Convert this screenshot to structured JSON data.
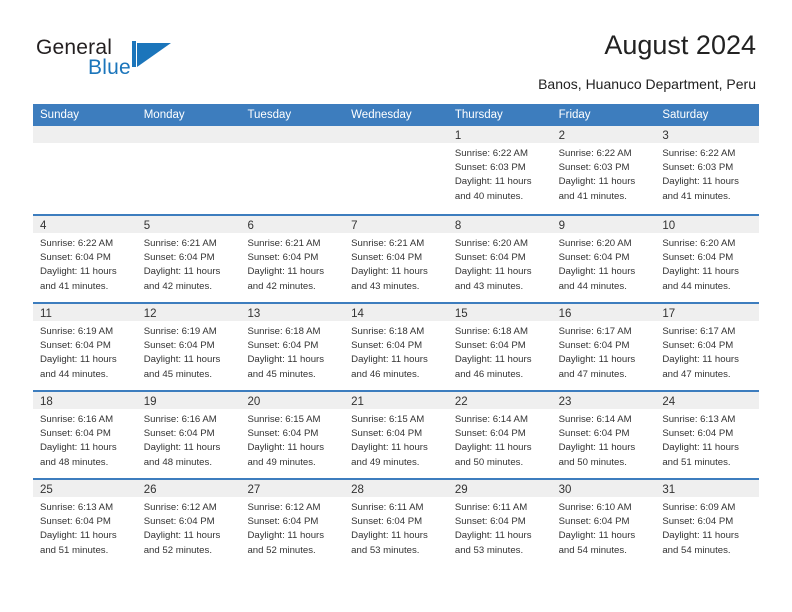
{
  "brand": {
    "name_part1": "General",
    "name_part2": "Blue",
    "mark": "triangle-flag-logo"
  },
  "header": {
    "title": "August 2024",
    "subtitle": "Banos, Huanuco Department, Peru"
  },
  "colors": {
    "header_blue": "#3d7dbe",
    "brand_blue": "#1b75bb",
    "daynum_band": "#efefef",
    "text": "#333333"
  },
  "weekday_headers": [
    "Sunday",
    "Monday",
    "Tuesday",
    "Wednesday",
    "Thursday",
    "Friday",
    "Saturday"
  ],
  "labels": {
    "sunrise_prefix": "Sunrise:",
    "sunset_prefix": "Sunset:",
    "daylight_prefix": "Daylight:"
  },
  "weeks": [
    [
      {
        "day": "",
        "empty": true
      },
      {
        "day": "",
        "empty": true
      },
      {
        "day": "",
        "empty": true
      },
      {
        "day": "",
        "empty": true
      },
      {
        "day": "1",
        "sunrise": "Sunrise: 6:22 AM",
        "sunset": "Sunset: 6:03 PM",
        "daylight_1": "Daylight: 11 hours",
        "daylight_2": "and 40 minutes."
      },
      {
        "day": "2",
        "sunrise": "Sunrise: 6:22 AM",
        "sunset": "Sunset: 6:03 PM",
        "daylight_1": "Daylight: 11 hours",
        "daylight_2": "and 41 minutes."
      },
      {
        "day": "3",
        "sunrise": "Sunrise: 6:22 AM",
        "sunset": "Sunset: 6:03 PM",
        "daylight_1": "Daylight: 11 hours",
        "daylight_2": "and 41 minutes."
      }
    ],
    [
      {
        "day": "4",
        "sunrise": "Sunrise: 6:22 AM",
        "sunset": "Sunset: 6:04 PM",
        "daylight_1": "Daylight: 11 hours",
        "daylight_2": "and 41 minutes."
      },
      {
        "day": "5",
        "sunrise": "Sunrise: 6:21 AM",
        "sunset": "Sunset: 6:04 PM",
        "daylight_1": "Daylight: 11 hours",
        "daylight_2": "and 42 minutes."
      },
      {
        "day": "6",
        "sunrise": "Sunrise: 6:21 AM",
        "sunset": "Sunset: 6:04 PM",
        "daylight_1": "Daylight: 11 hours",
        "daylight_2": "and 42 minutes."
      },
      {
        "day": "7",
        "sunrise": "Sunrise: 6:21 AM",
        "sunset": "Sunset: 6:04 PM",
        "daylight_1": "Daylight: 11 hours",
        "daylight_2": "and 43 minutes."
      },
      {
        "day": "8",
        "sunrise": "Sunrise: 6:20 AM",
        "sunset": "Sunset: 6:04 PM",
        "daylight_1": "Daylight: 11 hours",
        "daylight_2": "and 43 minutes."
      },
      {
        "day": "9",
        "sunrise": "Sunrise: 6:20 AM",
        "sunset": "Sunset: 6:04 PM",
        "daylight_1": "Daylight: 11 hours",
        "daylight_2": "and 44 minutes."
      },
      {
        "day": "10",
        "sunrise": "Sunrise: 6:20 AM",
        "sunset": "Sunset: 6:04 PM",
        "daylight_1": "Daylight: 11 hours",
        "daylight_2": "and 44 minutes."
      }
    ],
    [
      {
        "day": "11",
        "sunrise": "Sunrise: 6:19 AM",
        "sunset": "Sunset: 6:04 PM",
        "daylight_1": "Daylight: 11 hours",
        "daylight_2": "and 44 minutes."
      },
      {
        "day": "12",
        "sunrise": "Sunrise: 6:19 AM",
        "sunset": "Sunset: 6:04 PM",
        "daylight_1": "Daylight: 11 hours",
        "daylight_2": "and 45 minutes."
      },
      {
        "day": "13",
        "sunrise": "Sunrise: 6:18 AM",
        "sunset": "Sunset: 6:04 PM",
        "daylight_1": "Daylight: 11 hours",
        "daylight_2": "and 45 minutes."
      },
      {
        "day": "14",
        "sunrise": "Sunrise: 6:18 AM",
        "sunset": "Sunset: 6:04 PM",
        "daylight_1": "Daylight: 11 hours",
        "daylight_2": "and 46 minutes."
      },
      {
        "day": "15",
        "sunrise": "Sunrise: 6:18 AM",
        "sunset": "Sunset: 6:04 PM",
        "daylight_1": "Daylight: 11 hours",
        "daylight_2": "and 46 minutes."
      },
      {
        "day": "16",
        "sunrise": "Sunrise: 6:17 AM",
        "sunset": "Sunset: 6:04 PM",
        "daylight_1": "Daylight: 11 hours",
        "daylight_2": "and 47 minutes."
      },
      {
        "day": "17",
        "sunrise": "Sunrise: 6:17 AM",
        "sunset": "Sunset: 6:04 PM",
        "daylight_1": "Daylight: 11 hours",
        "daylight_2": "and 47 minutes."
      }
    ],
    [
      {
        "day": "18",
        "sunrise": "Sunrise: 6:16 AM",
        "sunset": "Sunset: 6:04 PM",
        "daylight_1": "Daylight: 11 hours",
        "daylight_2": "and 48 minutes."
      },
      {
        "day": "19",
        "sunrise": "Sunrise: 6:16 AM",
        "sunset": "Sunset: 6:04 PM",
        "daylight_1": "Daylight: 11 hours",
        "daylight_2": "and 48 minutes."
      },
      {
        "day": "20",
        "sunrise": "Sunrise: 6:15 AM",
        "sunset": "Sunset: 6:04 PM",
        "daylight_1": "Daylight: 11 hours",
        "daylight_2": "and 49 minutes."
      },
      {
        "day": "21",
        "sunrise": "Sunrise: 6:15 AM",
        "sunset": "Sunset: 6:04 PM",
        "daylight_1": "Daylight: 11 hours",
        "daylight_2": "and 49 minutes."
      },
      {
        "day": "22",
        "sunrise": "Sunrise: 6:14 AM",
        "sunset": "Sunset: 6:04 PM",
        "daylight_1": "Daylight: 11 hours",
        "daylight_2": "and 50 minutes."
      },
      {
        "day": "23",
        "sunrise": "Sunrise: 6:14 AM",
        "sunset": "Sunset: 6:04 PM",
        "daylight_1": "Daylight: 11 hours",
        "daylight_2": "and 50 minutes."
      },
      {
        "day": "24",
        "sunrise": "Sunrise: 6:13 AM",
        "sunset": "Sunset: 6:04 PM",
        "daylight_1": "Daylight: 11 hours",
        "daylight_2": "and 51 minutes."
      }
    ],
    [
      {
        "day": "25",
        "sunrise": "Sunrise: 6:13 AM",
        "sunset": "Sunset: 6:04 PM",
        "daylight_1": "Daylight: 11 hours",
        "daylight_2": "and 51 minutes."
      },
      {
        "day": "26",
        "sunrise": "Sunrise: 6:12 AM",
        "sunset": "Sunset: 6:04 PM",
        "daylight_1": "Daylight: 11 hours",
        "daylight_2": "and 52 minutes."
      },
      {
        "day": "27",
        "sunrise": "Sunrise: 6:12 AM",
        "sunset": "Sunset: 6:04 PM",
        "daylight_1": "Daylight: 11 hours",
        "daylight_2": "and 52 minutes."
      },
      {
        "day": "28",
        "sunrise": "Sunrise: 6:11 AM",
        "sunset": "Sunset: 6:04 PM",
        "daylight_1": "Daylight: 11 hours",
        "daylight_2": "and 53 minutes."
      },
      {
        "day": "29",
        "sunrise": "Sunrise: 6:11 AM",
        "sunset": "Sunset: 6:04 PM",
        "daylight_1": "Daylight: 11 hours",
        "daylight_2": "and 53 minutes."
      },
      {
        "day": "30",
        "sunrise": "Sunrise: 6:10 AM",
        "sunset": "Sunset: 6:04 PM",
        "daylight_1": "Daylight: 11 hours",
        "daylight_2": "and 54 minutes."
      },
      {
        "day": "31",
        "sunrise": "Sunrise: 6:09 AM",
        "sunset": "Sunset: 6:04 PM",
        "daylight_1": "Daylight: 11 hours",
        "daylight_2": "and 54 minutes."
      }
    ]
  ]
}
